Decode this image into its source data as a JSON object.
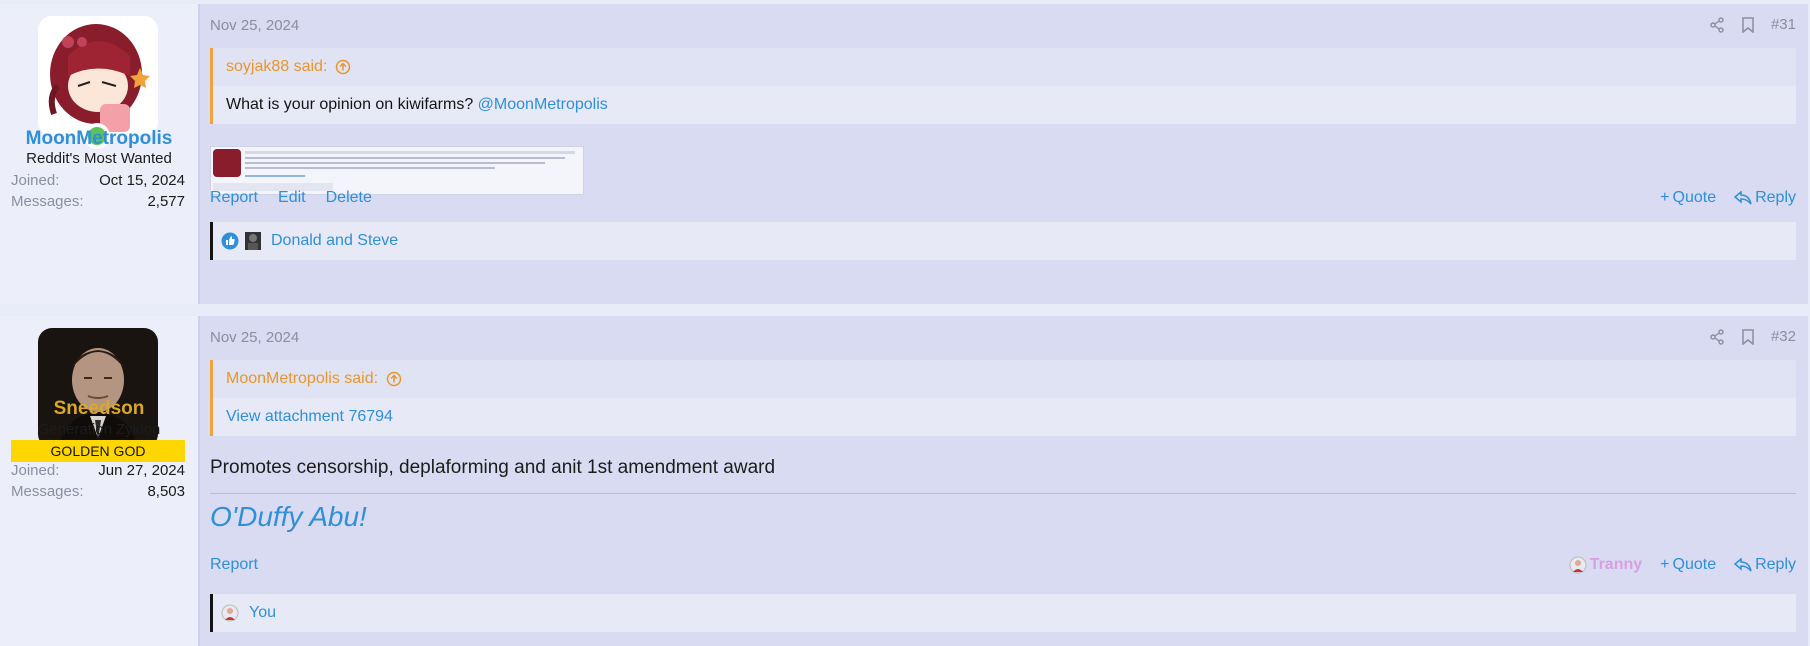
{
  "posts": [
    {
      "user": {
        "name": "MoonMetropolis",
        "title": "Reddit's Most Wanted",
        "joined_label": "Joined:",
        "joined": "Oct 15, 2024",
        "messages_label": "Messages:",
        "messages": "2,577",
        "name_color": "#2f8fd8"
      },
      "date": "Nov 25, 2024",
      "number": "#31",
      "quote": {
        "author": "soyjak88 said:",
        "text": "What is your opinion on kiwifarms?",
        "mention": "@MoonMetropolis"
      },
      "actions_left": [
        "Report",
        "Edit",
        "Delete"
      ],
      "quote_label": "Quote",
      "reply_label": "Reply",
      "reactions": "Donald and Steve"
    },
    {
      "user": {
        "name": "Sneedson",
        "title": "Generation Zyklon",
        "banner": "GOLDEN GOD",
        "joined_label": "Joined:",
        "joined": "Jun 27, 2024",
        "messages_label": "Messages:",
        "messages": "8,503",
        "name_color": "#d9a72b"
      },
      "date": "Nov 25, 2024",
      "number": "#32",
      "quote": {
        "author": "MoonMetropolis said:",
        "attachment": "View attachment 76794"
      },
      "body": "Promotes censorship, deplaforming and anit 1st amendment award",
      "signature": "O'Duffy Abu!",
      "actions_left": [
        "Report"
      ],
      "reaction_label": "Tranny",
      "quote_label": "Quote",
      "reply_label": "Reply",
      "reactions": "You"
    }
  ]
}
